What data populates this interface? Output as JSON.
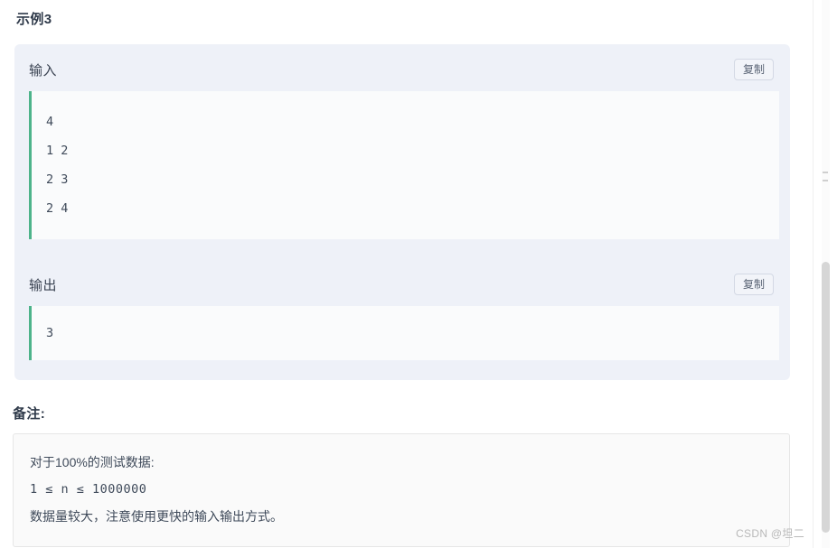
{
  "example": {
    "title": "示例3",
    "input": {
      "label": "输入",
      "copy_label": "复制",
      "lines": [
        "4",
        "1 2",
        "2 3",
        "2 4"
      ]
    },
    "output": {
      "label": "输出",
      "copy_label": "复制",
      "lines": [
        "3"
      ]
    }
  },
  "notes": {
    "title": "备注:",
    "lines": [
      "对于100%的测试数据:",
      "1 ≤ n ≤ 1000000",
      "数据量较大，注意使用更快的输入输出方式。"
    ]
  },
  "watermark": "CSDN @坦二",
  "colors": {
    "card_bg": "#eef1f8",
    "code_bg": "#fafbfc",
    "accent_bar": "#4db38a",
    "text": "#3f4a5a"
  }
}
